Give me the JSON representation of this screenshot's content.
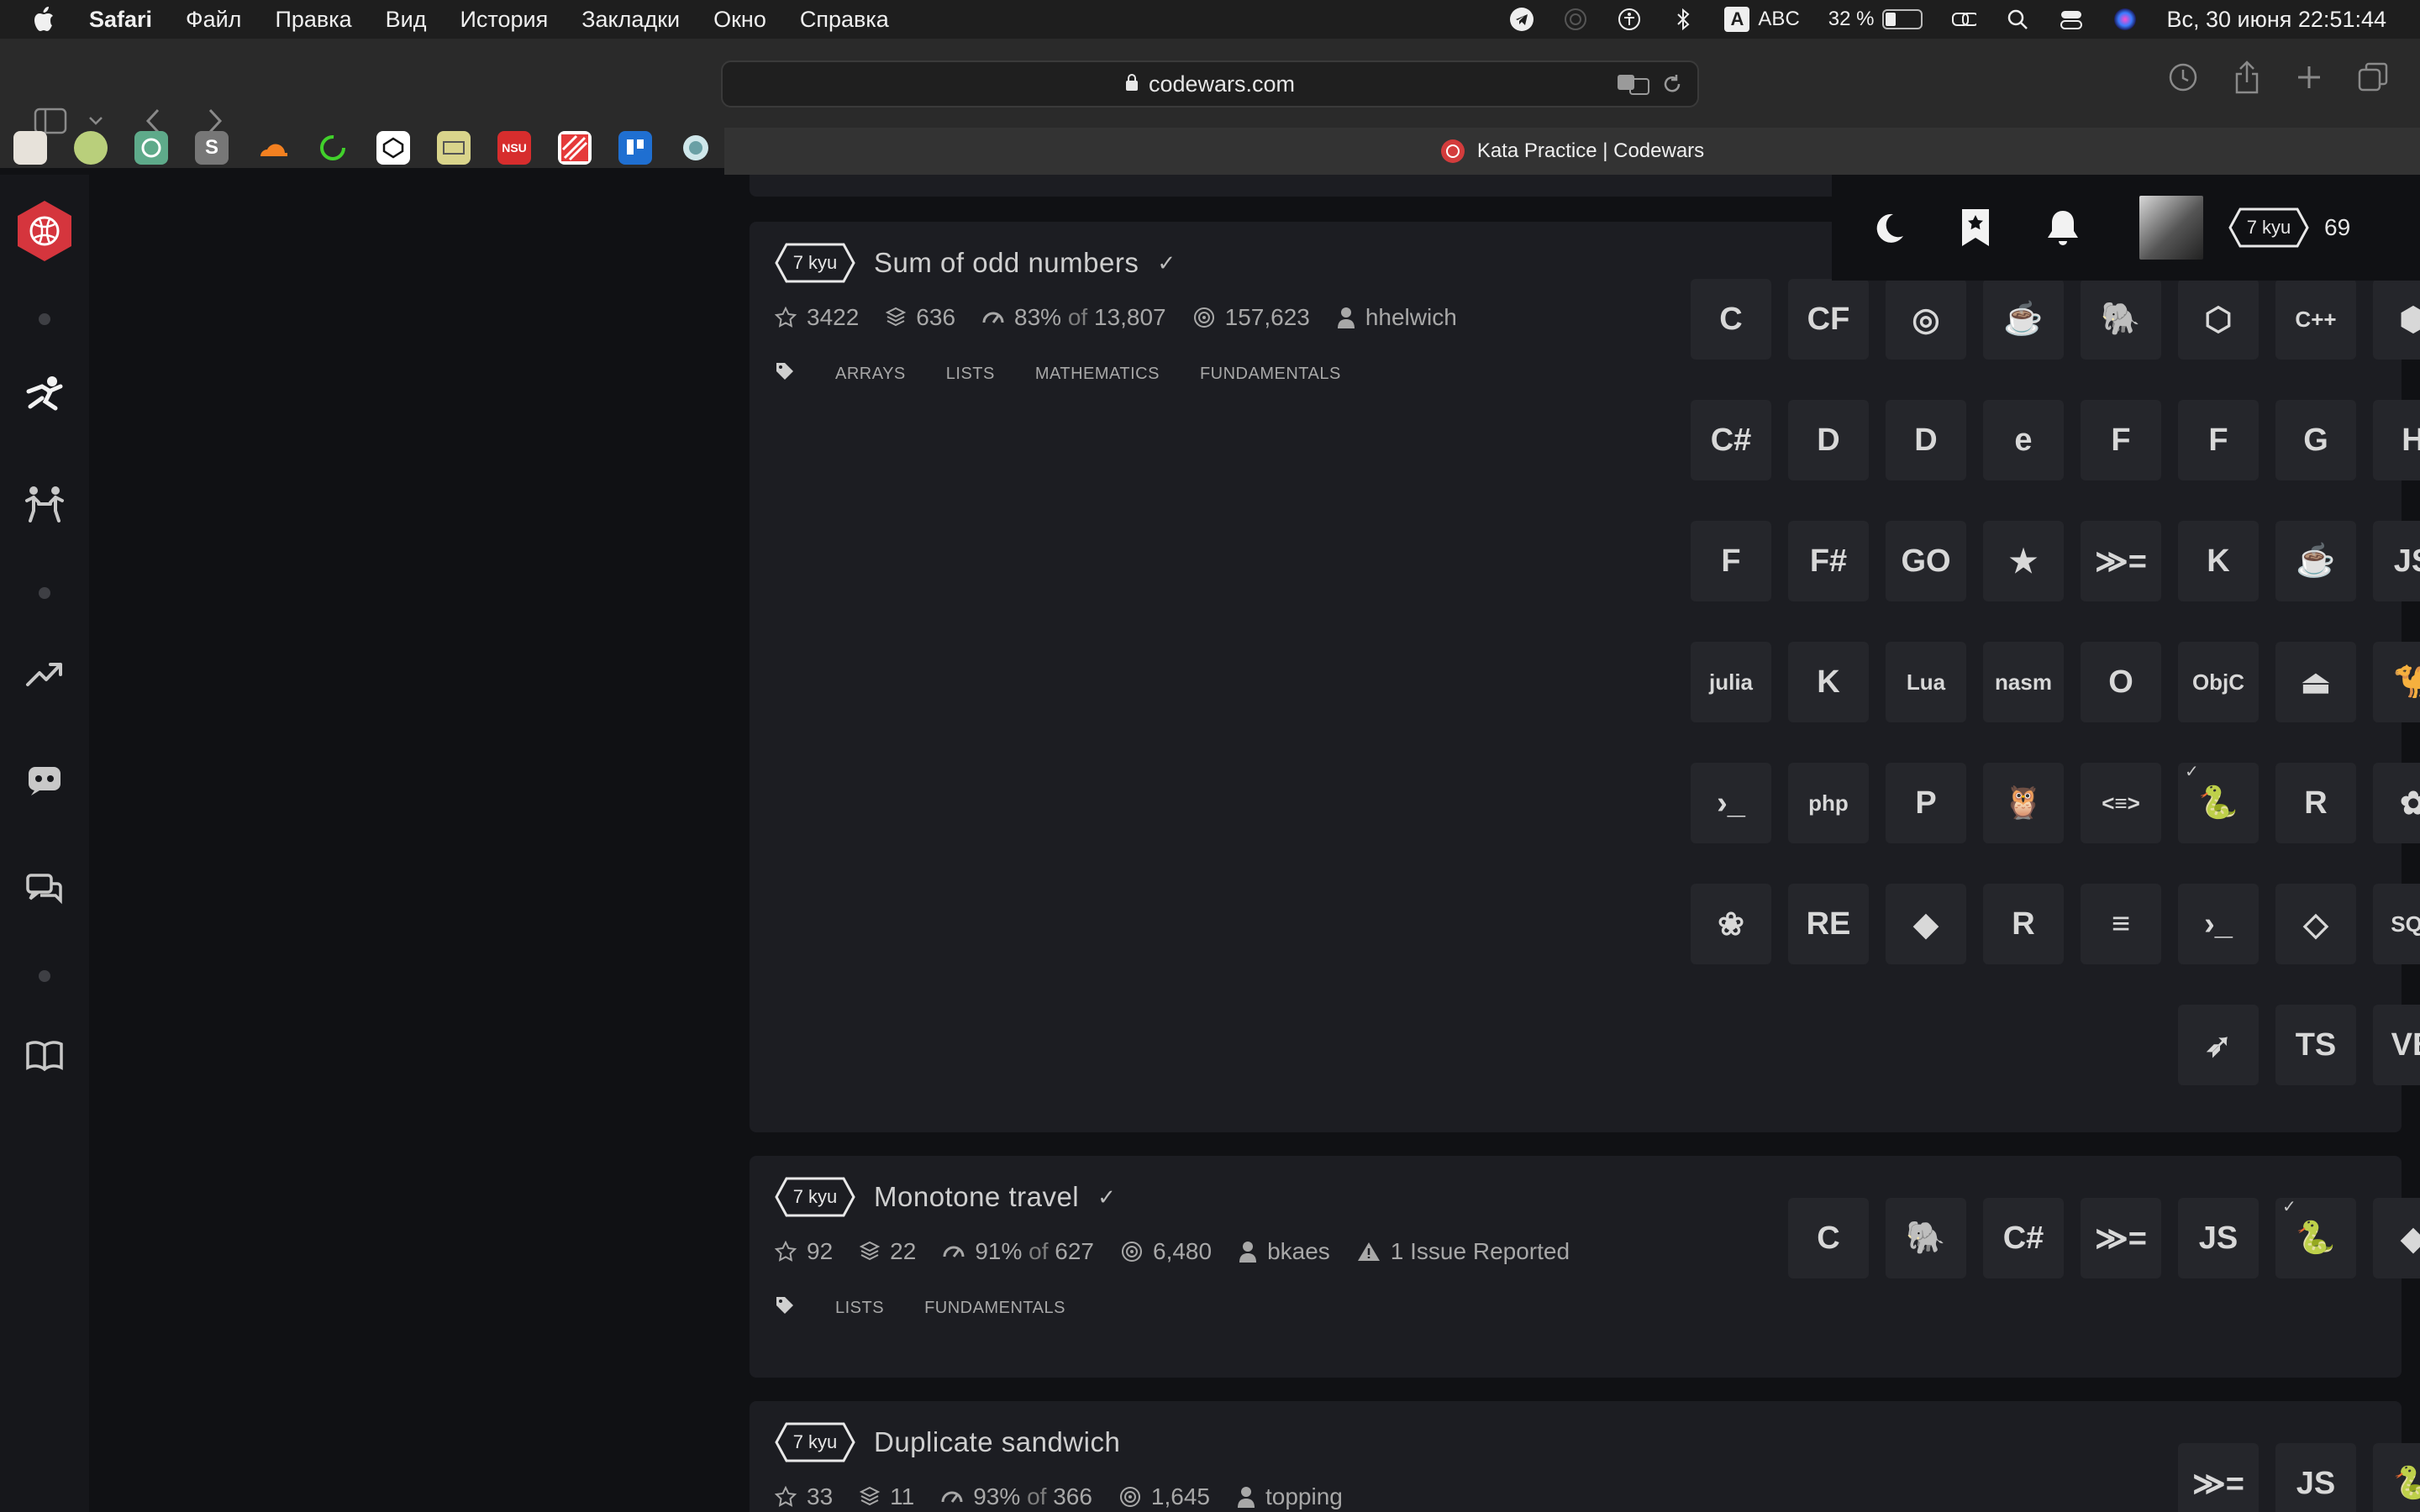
{
  "menubar": {
    "app": "Safari",
    "items": [
      "Файл",
      "Правка",
      "Вид",
      "История",
      "Закладки",
      "Окно",
      "Справка"
    ],
    "input_source": "ABC",
    "battery": "32 %",
    "datetime": "Вс, 30 июня  22:51:44"
  },
  "browser": {
    "url": "codewars.com",
    "tab_title": "Kata Practice | Codewars",
    "favorites": [
      "S",
      "NSU"
    ]
  },
  "user": {
    "rank": "7 kyu",
    "honor": "69"
  },
  "katas": [
    {
      "rank": "7 kyu",
      "title": "Sum of odd numbers",
      "stars": "3422",
      "collections": "636",
      "satisfaction": "83%",
      "of_word": "of",
      "votes": "13,807",
      "completed": "157,623",
      "author": "hhelwich",
      "tags": [
        "ARRAYS",
        "LISTS",
        "MATHEMATICS",
        "FUNDAMENTALS"
      ],
      "languages": [
        "C",
        "CF",
        "Clojure",
        "CoffeeScript",
        "COBOL",
        "Crystal",
        "C++",
        "Elixir-like",
        "C#",
        "D",
        "Dart",
        "Elm",
        "Factor",
        "Fortran-like",
        "Groovy-dino",
        "Haskell-box",
        "F",
        "F#",
        "GO",
        "Idris",
        "Haskell",
        "Kotlin-like",
        "Java",
        "JS",
        "julia",
        "Kotlin",
        "Lua",
        "nasm",
        "OCaml",
        "ObjC",
        "Pascal",
        "Perl",
        "PowerShell",
        "php",
        "PowerShell2",
        "Prolog",
        "PureScript",
        "Python",
        "R",
        "Raku",
        "Reason",
        "RE",
        "Ruby",
        "Rust",
        "Scala",
        "Shell",
        "Solidity",
        "SQL",
        "Swift",
        "TS",
        "VB"
      ]
    },
    {
      "rank": "7 kyu",
      "title": "Monotone travel",
      "stars": "92",
      "collections": "22",
      "satisfaction": "91%",
      "of_word": "of",
      "votes": "627",
      "completed": "6,480",
      "author": "bkaes",
      "issues": "1 Issue Reported",
      "tags": [
        "LISTS",
        "FUNDAMENTALS"
      ],
      "languages": [
        "C",
        "COBOL",
        "C#",
        "Haskell",
        "JS",
        "Python",
        "Ruby"
      ]
    },
    {
      "rank": "7 kyu",
      "title": "Duplicate sandwich",
      "stars": "33",
      "collections": "11",
      "satisfaction": "93%",
      "of_word": "of",
      "votes": "366",
      "completed": "1,645",
      "author": "topping",
      "languages": [
        "Haskell",
        "JS",
        "Python"
      ]
    }
  ]
}
